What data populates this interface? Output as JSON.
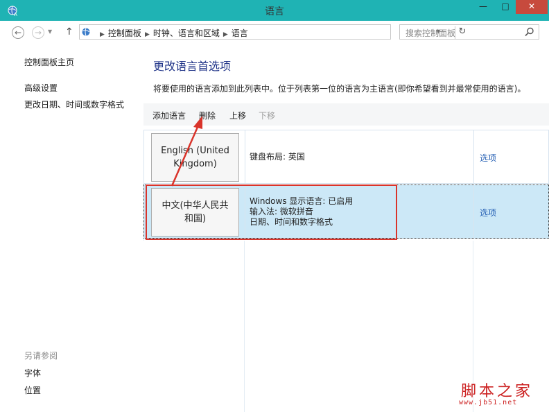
{
  "window": {
    "title": "语言",
    "min": "—",
    "max": "□",
    "close": "✕"
  },
  "nav": {
    "breadcrumbs": [
      "控制面板",
      "时钟、语言和区域",
      "语言"
    ],
    "search_placeholder": "搜索控制面板"
  },
  "sidebar": {
    "home": "控制面板主页",
    "links": [
      "高级设置",
      "更改日期、时间或数字格式"
    ],
    "see_also_heading": "另请参阅",
    "see_also": [
      "字体",
      "位置"
    ]
  },
  "main": {
    "heading": "更改语言首选项",
    "description": "将要使用的语言添加到此列表中。位于列表第一位的语言为主语言(即你希望看到并最常使用的语言)。",
    "toolbar": {
      "add": "添加语言",
      "remove": "删除",
      "move_up": "上移",
      "move_down": "下移"
    },
    "languages": [
      {
        "name": "English (United Kingdom)",
        "details": [
          "键盘布局: 英国"
        ],
        "options": "选项",
        "selected": false
      },
      {
        "name": "中文(中华人民共和国)",
        "details": [
          "Windows 显示语言: 已启用",
          "输入法: 微软拼音",
          "日期、时间和数字格式"
        ],
        "options": "选项",
        "selected": true
      }
    ]
  },
  "watermark": {
    "text": "脚本之家",
    "url": "www.jb51.net"
  },
  "colors": {
    "titlebar": "#1fb3b4",
    "close": "#c74a3d",
    "heading": "#1e3287",
    "link": "#2660b4",
    "selected_row": "#cce8f7",
    "annotation": "#d9342b"
  },
  "icons": {
    "app": "globe-clock-icon",
    "search": "magnifier-icon",
    "refresh": "refresh-icon"
  }
}
